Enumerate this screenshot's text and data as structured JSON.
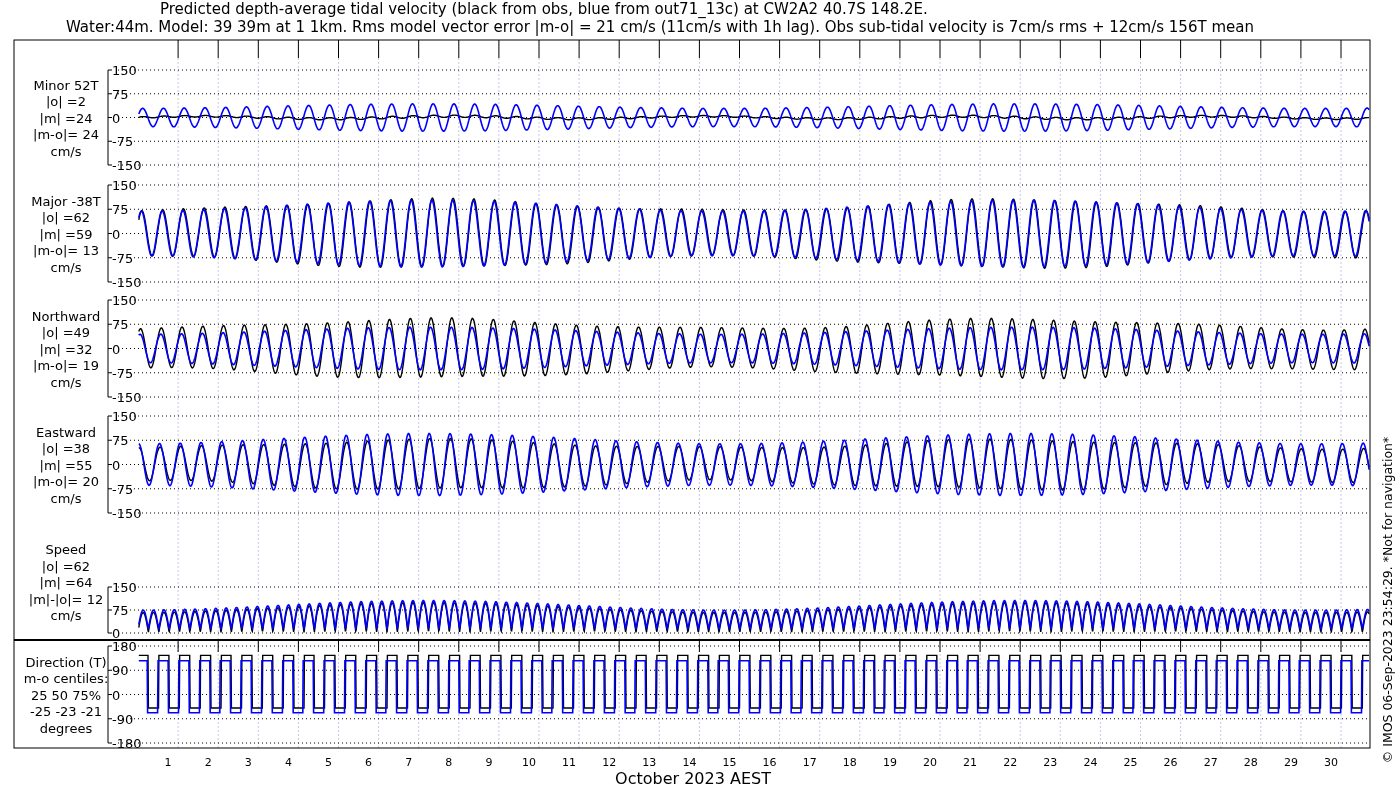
{
  "title_lines": [
    "Predicted depth-average tidal velocity (black from obs, blue from out71_13c) at CW2A2 40.7S 148.2E.",
    "Water:44m. Model: 39 39m at 1 1km. Rms model vector error |m-o| = 21 cm/s (11cm/s with 1h lag). Obs sub-tidal velocity is 7cm/s rms + 12cm/s 156T mean"
  ],
  "panels": [
    {
      "kind": "velocity",
      "label_lines": [
        "Minor 52T",
        "|o| =2",
        "|m| =24",
        "|m-o|= 24",
        "cm/s"
      ],
      "y_ticks": [
        "150",
        "75",
        "0",
        "-75",
        "-150"
      ]
    },
    {
      "kind": "velocity",
      "label_lines": [
        "Major -38T",
        "|o| =62",
        "|m| =59",
        "|m-o|= 13",
        "cm/s"
      ],
      "y_ticks": [
        "150",
        "75",
        "0",
        "-75",
        "-150"
      ]
    },
    {
      "kind": "velocity",
      "label_lines": [
        "Northward",
        "|o| =49",
        "|m| =32",
        "|m-o|= 19",
        "cm/s"
      ],
      "y_ticks": [
        "150",
        "75",
        "0",
        "-75",
        "-150"
      ]
    },
    {
      "kind": "velocity",
      "label_lines": [
        "Eastward",
        "|o| =38",
        "|m| =55",
        "|m-o|= 20",
        "cm/s"
      ],
      "y_ticks": [
        "150",
        "75",
        "0",
        "-75",
        "-150"
      ]
    },
    {
      "kind": "speed",
      "label_lines": [
        "Speed",
        "|o| =62",
        "|m| =64",
        "|m|-|o|= 12",
        "cm/s"
      ],
      "y_ticks": [
        "150",
        "75",
        "0"
      ]
    },
    {
      "kind": "direction",
      "label_lines": [
        "Direction (T)",
        "m-o centiles:",
        "25  50  75%",
        "-25 -23 -21",
        "degrees"
      ],
      "y_ticks": [
        "180",
        "90",
        "0",
        "-90",
        "-180"
      ]
    }
  ],
  "x_axis": {
    "day_labels": [
      "1",
      "2",
      "3",
      "4",
      "5",
      "6",
      "7",
      "8",
      "9",
      "10",
      "11",
      "12",
      "13",
      "14",
      "15",
      "16",
      "17",
      "18",
      "19",
      "20",
      "21",
      "22",
      "23",
      "24",
      "25",
      "26",
      "27",
      "28",
      "29",
      "30"
    ],
    "title": "October 2023 AEST"
  },
  "credit": "© IMOS 06-Sep-2023 23:54:29. *Not for navigation*"
}
